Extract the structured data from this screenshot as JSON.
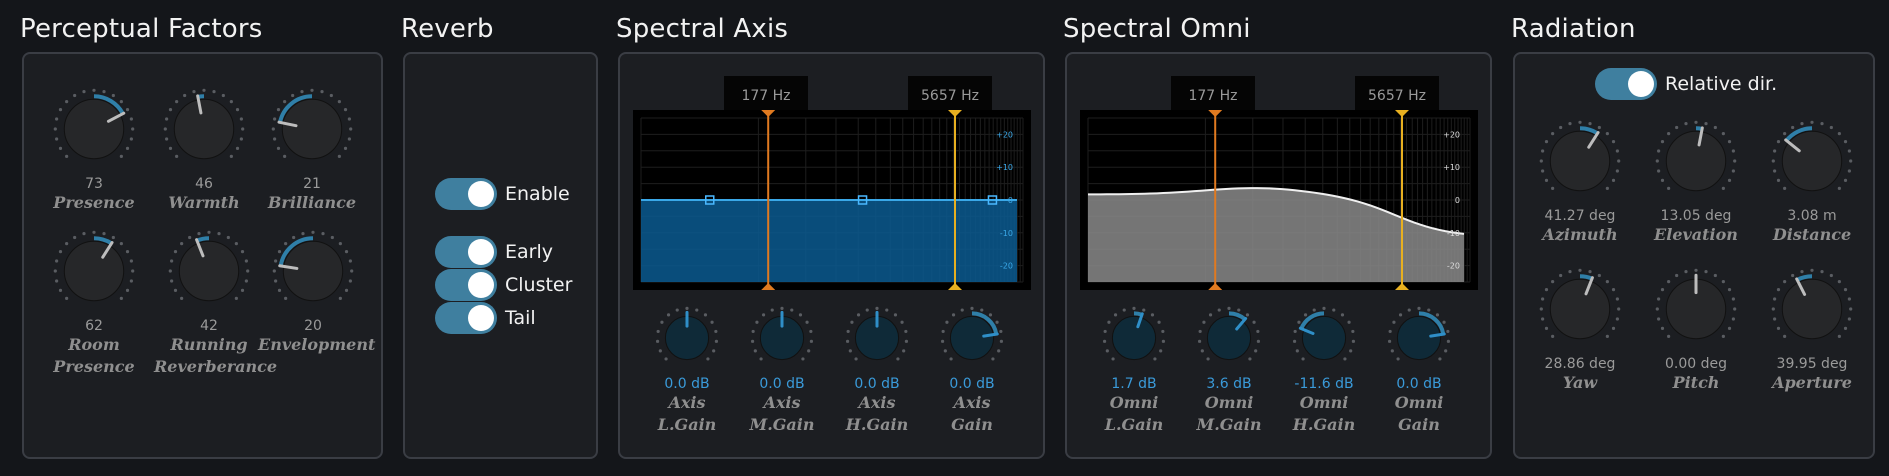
{
  "sections": {
    "perceptual": "Perceptual Factors",
    "reverb": "Reverb",
    "spectral_axis": "Spectral Axis",
    "spectral_omni": "Spectral Omni",
    "radiation": "Radiation"
  },
  "perceptual": {
    "knobs": [
      {
        "value": "73",
        "label1": "Presence",
        "label2": "",
        "level": 0.73
      },
      {
        "value": "46",
        "label1": "Warmth",
        "label2": "",
        "level": 0.46
      },
      {
        "value": "21",
        "label1": "Brilliance",
        "label2": "",
        "level": 0.21
      },
      {
        "value": "62",
        "label1": "Room",
        "label2": "Presence",
        "level": 0.62
      },
      {
        "value": "42",
        "label1": "Running",
        "label2": "Reverberance",
        "level": 0.42
      },
      {
        "value": "20",
        "label1": "Envelopment",
        "label2": "",
        "level": 0.2
      }
    ]
  },
  "reverb": {
    "enable": "Enable",
    "early": "Early",
    "cluster": "Cluster",
    "tail": "Tail"
  },
  "spectral_axis": {
    "low_freq": "177 Hz",
    "high_freq": "5657 Hz",
    "db_ticks": [
      "+20",
      "+10",
      "0",
      "-10",
      "-20"
    ],
    "knobs": [
      {
        "value": "0.0 dB",
        "label1": "Axis",
        "label2": "L.Gain",
        "level": 0.5
      },
      {
        "value": "0.0 dB",
        "label1": "Axis",
        "label2": "M.Gain",
        "level": 0.5
      },
      {
        "value": "0.0 dB",
        "label1": "Axis",
        "label2": "H.Gain",
        "level": 0.5
      },
      {
        "value": "0.0 dB",
        "label1": "Axis",
        "label2": "Gain",
        "level": 0.8
      }
    ]
  },
  "spectral_omni": {
    "low_freq": "177 Hz",
    "high_freq": "5657 Hz",
    "db_ticks": [
      "+20",
      "+10",
      "0",
      "-10",
      "-20"
    ],
    "knobs": [
      {
        "value": "1.7 dB",
        "label1": "Omni",
        "label2": "L.Gain",
        "level": 0.57
      },
      {
        "value": "3.6 dB",
        "label1": "Omni",
        "label2": "M.Gain",
        "level": 0.65
      },
      {
        "value": "-11.6 dB",
        "label1": "Omni",
        "label2": "H.Gain",
        "level": 0.25
      },
      {
        "value": "0.0 dB",
        "label1": "Omni",
        "label2": "Gain",
        "level": 0.8
      }
    ]
  },
  "radiation": {
    "relative_dir": "Relative dir.",
    "knobs": [
      {
        "value": "41.27 deg",
        "label": "Azimuth",
        "level": 0.62
      },
      {
        "value": "13.05 deg",
        "label": "Elevation",
        "level": 0.54
      },
      {
        "value": "3.08 m",
        "label": "Distance",
        "level": 0.31
      },
      {
        "value": "28.86 deg",
        "label": "Yaw",
        "level": 0.58
      },
      {
        "value": "0.00 deg",
        "label": "Pitch",
        "level": 0.5
      },
      {
        "value": "39.95 deg",
        "label": "Aperture",
        "level": 0.4
      }
    ]
  },
  "colors": {
    "accent": "#2f7fa8",
    "orange": "#e07a20",
    "yellow": "#e8b020",
    "eq_fill": "#0a5a90"
  }
}
